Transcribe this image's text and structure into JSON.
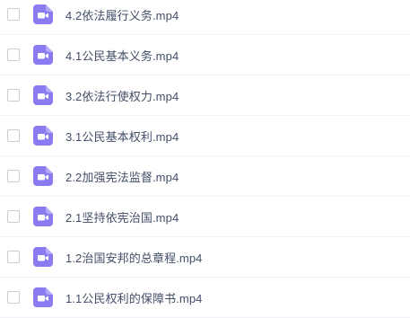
{
  "files": [
    {
      "name": "4.2依法履行义务.mp4",
      "icon": "video-file-icon"
    },
    {
      "name": "4.1公民基本义务.mp4",
      "icon": "video-file-icon"
    },
    {
      "name": "3.2依法行使权力.mp4",
      "icon": "video-file-icon"
    },
    {
      "name": "3.1公民基本权利.mp4",
      "icon": "video-file-icon"
    },
    {
      "name": "2.2加强宪法监督.mp4",
      "icon": "video-file-icon"
    },
    {
      "name": "2.1坚持依宪治国.mp4",
      "icon": "video-file-icon"
    },
    {
      "name": "1.2治国安邦的总章程.mp4",
      "icon": "video-file-icon"
    },
    {
      "name": "1.1公民权利的保障书.mp4",
      "icon": "video-file-icon"
    }
  ],
  "colors": {
    "icon_bg": "#8a7cf0",
    "text": "#424e67",
    "checkbox_border": "#c9cdd4",
    "row_divider": "#f1f2f5"
  }
}
